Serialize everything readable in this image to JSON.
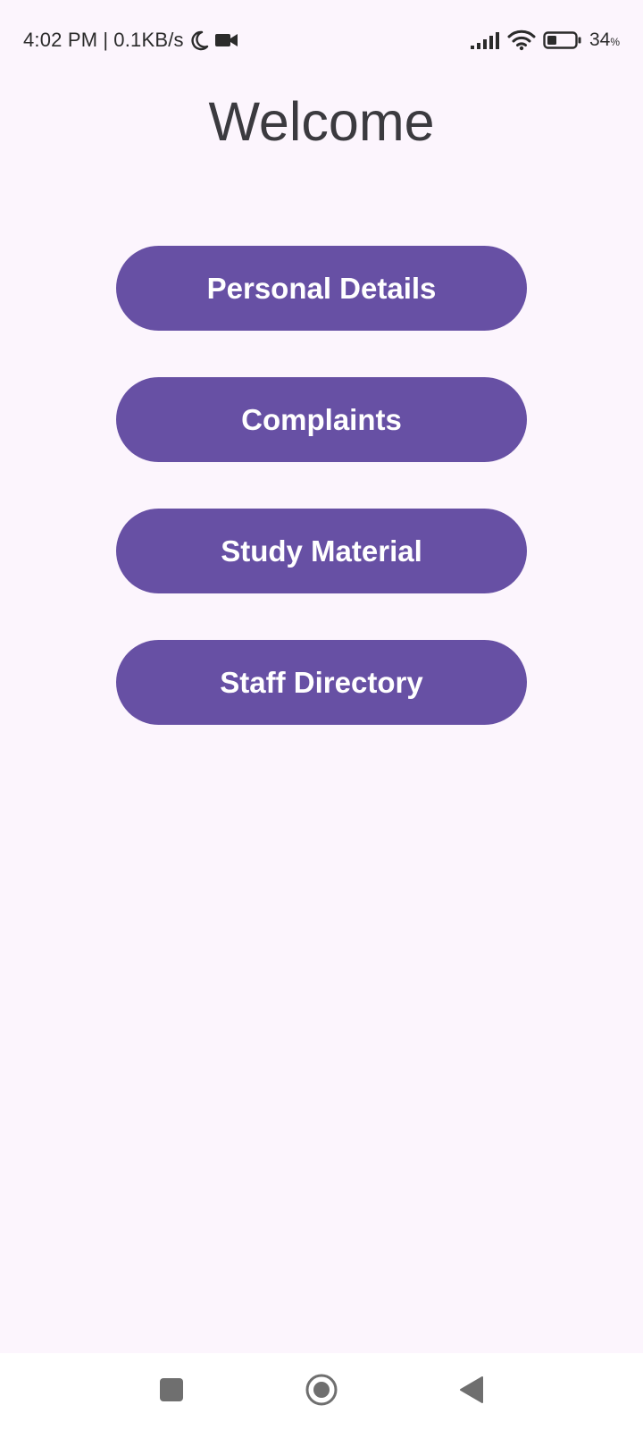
{
  "status_bar": {
    "time": "4:02 PM",
    "separator": "|",
    "net_speed": "0.1KB/s",
    "icons": [
      "moon-icon",
      "video-camera-icon",
      "signal-icon",
      "wifi-icon",
      "battery-icon"
    ],
    "battery_percent": "34",
    "battery_symbol": "%",
    "battery_level": 0.34
  },
  "main": {
    "title": "Welcome",
    "buttons": [
      {
        "label": "Personal Details"
      },
      {
        "label": "Complaints"
      },
      {
        "label": "Study Material"
      },
      {
        "label": "Staff Directory"
      }
    ]
  },
  "nav_bar": {
    "icons": [
      "recents-icon",
      "home-icon",
      "back-icon"
    ]
  },
  "colors": {
    "background": "#FCF5FD",
    "button_fill": "#6750A4",
    "button_text": "#FFFFFF",
    "title_text": "#3B3A3F",
    "nav_icon": "#6F6F6F"
  }
}
